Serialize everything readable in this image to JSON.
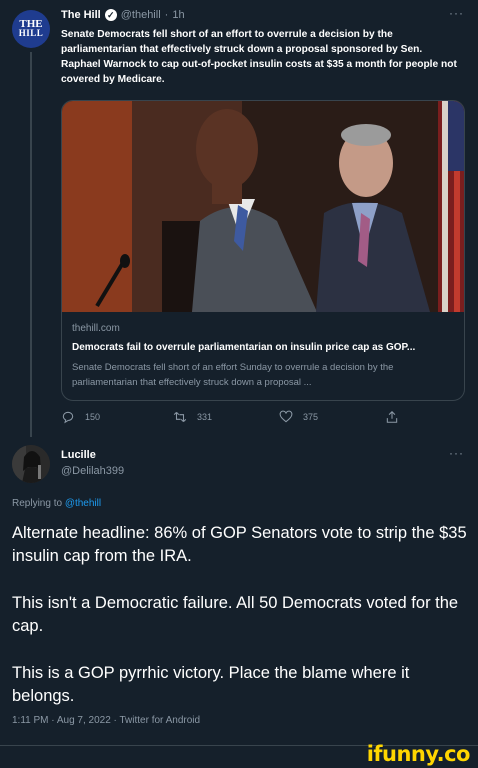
{
  "tweet": {
    "author_name": "The Hill",
    "handle": "@thehill",
    "separator": "·",
    "time": "1h",
    "avatar_text_line1": "THE",
    "avatar_text_line2": "HILL",
    "text": "Senate Democrats fell short of an effort to overrule a decision by the parliamentarian that effectively struck down a proposal sponsored by Sen. Raphael Warnock to cap out-of-pocket insulin costs at $35 a month for people not covered by Medicare.",
    "card": {
      "domain": "thehill.com",
      "title": "Democrats fail to overrule parliamentarian on insulin price cap as GOP...",
      "description": "Senate Democrats fell short of an effort Sunday to overrule a decision by the parliamentarian that effectively struck down a proposal ..."
    },
    "actions": {
      "replies": "150",
      "retweets": "331",
      "likes": "375"
    }
  },
  "reply_tweet": {
    "author_name": "Lucille",
    "handle": "@Delilah399",
    "replying_prefix": "Replying to",
    "replying_to": "@thehill",
    "paragraphs": [
      "Alternate headline: 86% of GOP Senators vote to strip the $35 insulin cap from the IRA.",
      "This isn't a Democratic failure. All 50 Democrats voted for the cap.",
      "This is a GOP pyrrhic victory. Place the blame where it belongs."
    ],
    "meta": "1:11 PM · Aug 7, 2022 · Twitter for Android"
  },
  "more_glyph": "···",
  "watermark": "ifunny.co",
  "icons": {
    "verified": "verified-check-icon",
    "reply": "reply-bubble-icon",
    "retweet": "retweet-icon",
    "like": "heart-icon",
    "share": "share-icon"
  },
  "colors": {
    "background": "#15202b",
    "muted": "#8b98a5",
    "link": "#1d9bf0",
    "watermark": "#ffd600"
  }
}
